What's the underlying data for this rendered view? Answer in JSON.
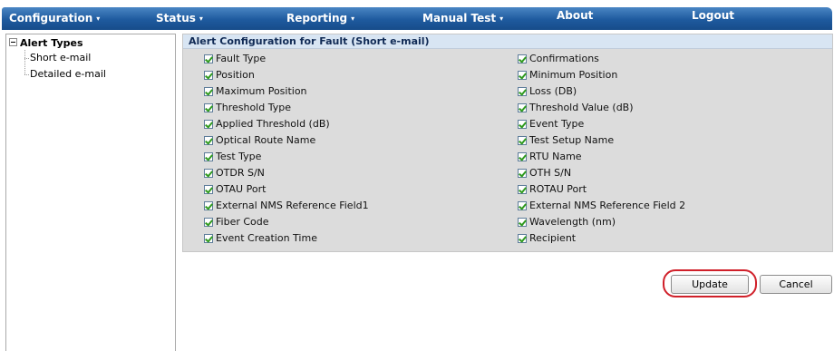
{
  "nav": {
    "configuration": "Configuration",
    "status": "Status",
    "reporting": "Reporting",
    "manual_test": "Manual Test",
    "about": "About",
    "logout": "Logout",
    "dropdown_icon": "▾"
  },
  "tree": {
    "root_label": "Alert Types",
    "items": [
      "Short e-mail",
      "Detailed e-mail"
    ]
  },
  "panel": {
    "title": "Alert Configuration for Fault (Short e-mail)",
    "left_options": [
      "Fault Type",
      "Position",
      "Maximum Position",
      "Threshold Type",
      "Applied Threshold (dB)",
      "Optical Route Name",
      "Test Type",
      "OTDR S/N",
      "OTAU Port",
      "External NMS Reference Field1",
      "Fiber Code",
      "Event Creation Time"
    ],
    "right_options": [
      "Confirmations",
      "Minimum Position",
      "Loss (DB)",
      "Threshold Value (dB)",
      "Event Type",
      "Test Setup Name",
      "RTU Name",
      "OTH S/N",
      "ROTAU Port",
      "External NMS Reference Field 2",
      "Wavelength (nm)",
      "Recipient"
    ]
  },
  "buttons": {
    "update": "Update",
    "cancel": "Cancel"
  },
  "colors": {
    "navbar": "#1e5a9e",
    "panel_bg": "#dcdcdc",
    "panel_header": "#d8e5f3",
    "highlight": "#d0202a",
    "checkmark": "#2f9a1e"
  }
}
